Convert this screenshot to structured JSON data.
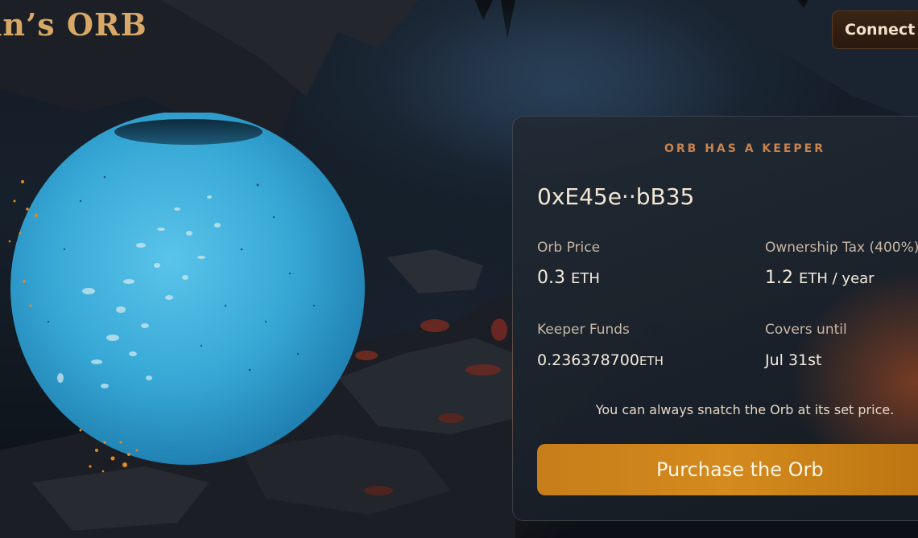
{
  "header": {
    "logo_text": "in’s ORB",
    "connect_label": "Connect Wallet"
  },
  "card": {
    "status_label": "ORB HAS A KEEPER",
    "keeper_address": "0xE45e··bB35",
    "orb_price": {
      "label": "Orb Price",
      "value": "0.3",
      "unit": "ETH"
    },
    "ownership_tax": {
      "label": "Ownership Tax (400%)",
      "value": "1.2",
      "unit": "ETH / year"
    },
    "keeper_funds": {
      "label": "Keeper Funds",
      "value": "0.236378700",
      "unit": "ETH"
    },
    "covers_until": {
      "label": "Covers until",
      "value": "Jul 31st"
    },
    "note": "You can always snatch the Orb at its set price.",
    "purchase_label": "Purchase the Orb"
  },
  "colors": {
    "accent": "#c9834e",
    "button": "#d48a1d",
    "orb": "#3fb0da"
  }
}
